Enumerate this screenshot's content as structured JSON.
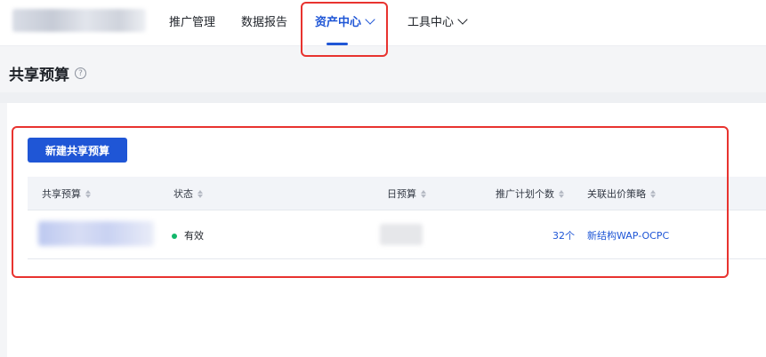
{
  "topnav": {
    "items": [
      {
        "label": "推广管理"
      },
      {
        "label": "数据报告"
      },
      {
        "label": "资产中心"
      },
      {
        "label": "工具中心"
      }
    ]
  },
  "page": {
    "title": "共享预算",
    "help_icon": "?"
  },
  "actions": {
    "new_button": "新建共享预算"
  },
  "table": {
    "columns": [
      "共享预算",
      "状态",
      "日预算",
      "推广计划个数",
      "关联出价策略"
    ],
    "rows": [
      {
        "status": "有效",
        "plan_count": "32个",
        "strategy": "新结构WAP-OCPC"
      }
    ]
  },
  "colors": {
    "accent": "#1f56d6",
    "highlight": "#e8332f",
    "status_ok": "#12b76a"
  }
}
